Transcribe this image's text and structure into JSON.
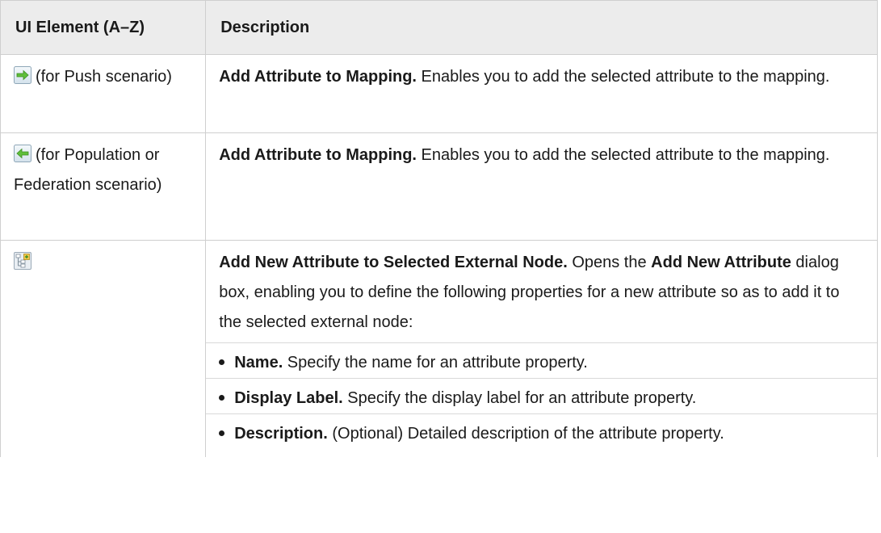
{
  "table": {
    "headers": {
      "element": "UI Element (A–Z)",
      "description": "Description"
    },
    "rows": [
      {
        "icon": "green-arrow-right-icon",
        "element_text": "(for Push scenario)",
        "desc_bold": "Add Attribute to Mapping.",
        "desc_text": " Enables you to add the selected attribute to the mapping."
      },
      {
        "icon": "green-arrow-left-icon",
        "element_text": "(for Population or Federation scenario)",
        "desc_bold": "Add Attribute to Mapping.",
        "desc_text": " Enables you to add the selected attribute to the mapping."
      },
      {
        "icon": "add-new-attribute-icon",
        "element_text": "",
        "desc_bold": "Add New Attribute to Selected External Node.",
        "desc_text_1": " Opens the ",
        "desc_bold_2": "Add New Attribute",
        "desc_text_2": " dialog box, enabling you to define the following properties for a new attribute so as to add it to the selected external node:",
        "bullets": [
          {
            "bold": "Name.",
            "text": " Specify the name for an attribute property."
          },
          {
            "bold": "Display Label.",
            "text": " Specify the display label for an attribute property."
          },
          {
            "bold": "Description.",
            "text": " (Optional) Detailed description of the attribute property."
          }
        ]
      }
    ]
  }
}
